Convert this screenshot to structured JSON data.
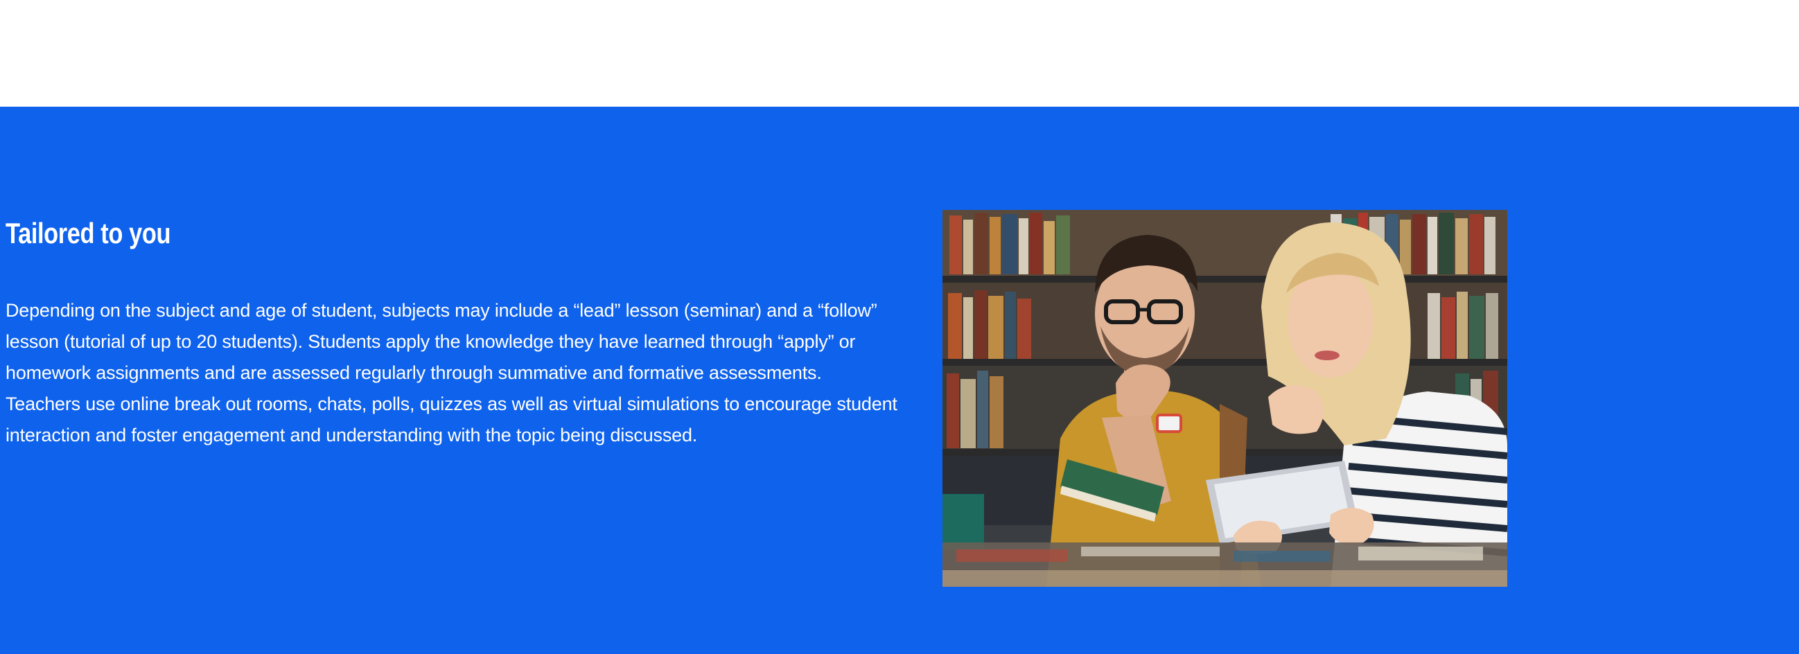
{
  "section": {
    "heading": "Tailored to you",
    "body": "Depending on the subject and age of student, subjects may include a “lead” lesson (seminar) and a “follow” lesson (tutorial of up to 20 students). Students apply the knowledge they have learned through “apply” or homework assignments and are assessed regularly through summative and formative assessments. Teachers use online break out rooms, chats, polls, quizzes as well as virtual simulations to encourage student interaction and foster engagement and understanding with the topic being discussed.",
    "image": {
      "icon": "photo-two-students-reading-tablet-in-library"
    }
  },
  "colors": {
    "section_background": "#0f62eb",
    "text": "#ffffff",
    "top_band": "#ffffff"
  }
}
